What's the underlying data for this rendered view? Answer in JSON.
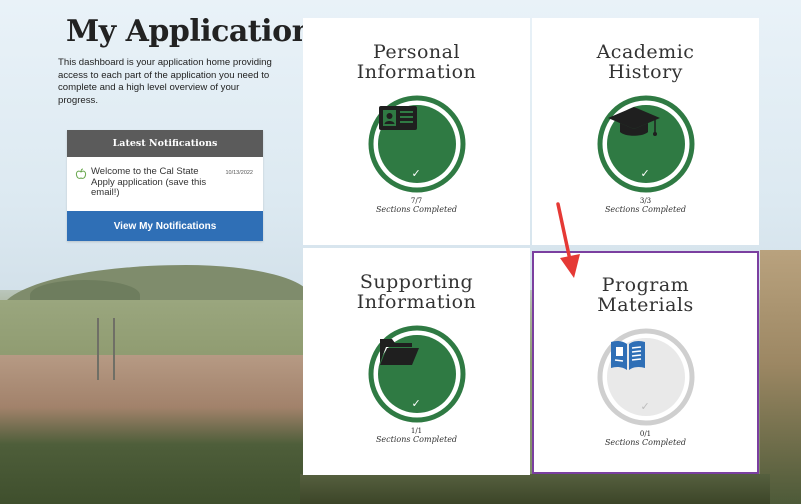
{
  "header": {
    "title": "My Application",
    "description": "This dashboard is your application home providing access to each part of the application you need to complete and a high level overview of your progress."
  },
  "notifications": {
    "heading": "Latest Notifications",
    "items": [
      {
        "text": "Welcome to the Cal State Apply application (save this email!)",
        "date": "10/13/2022"
      }
    ],
    "button_label": "View My Notifications"
  },
  "tiles": [
    {
      "title_line1": "Personal",
      "title_line2": "Information",
      "count": "7/7",
      "status": "Sections Completed",
      "icon": "id-card-icon",
      "complete": true
    },
    {
      "title_line1": "Academic",
      "title_line2": "History",
      "count": "3/3",
      "status": "Sections Completed",
      "icon": "graduation-cap-icon",
      "complete": true
    },
    {
      "title_line1": "Supporting",
      "title_line2": "Information",
      "count": "1/1",
      "status": "Sections Completed",
      "icon": "folder-icon",
      "complete": true
    },
    {
      "title_line1": "Program",
      "title_line2": "Materials",
      "count": "0/1",
      "status": "Sections Completed",
      "icon": "book-icon",
      "complete": false
    }
  ],
  "colors": {
    "complete_green": "#2f7a43",
    "button_blue": "#2f6fb6",
    "highlight_purple": "#7b3fa0",
    "arrow_red": "#e53935"
  }
}
